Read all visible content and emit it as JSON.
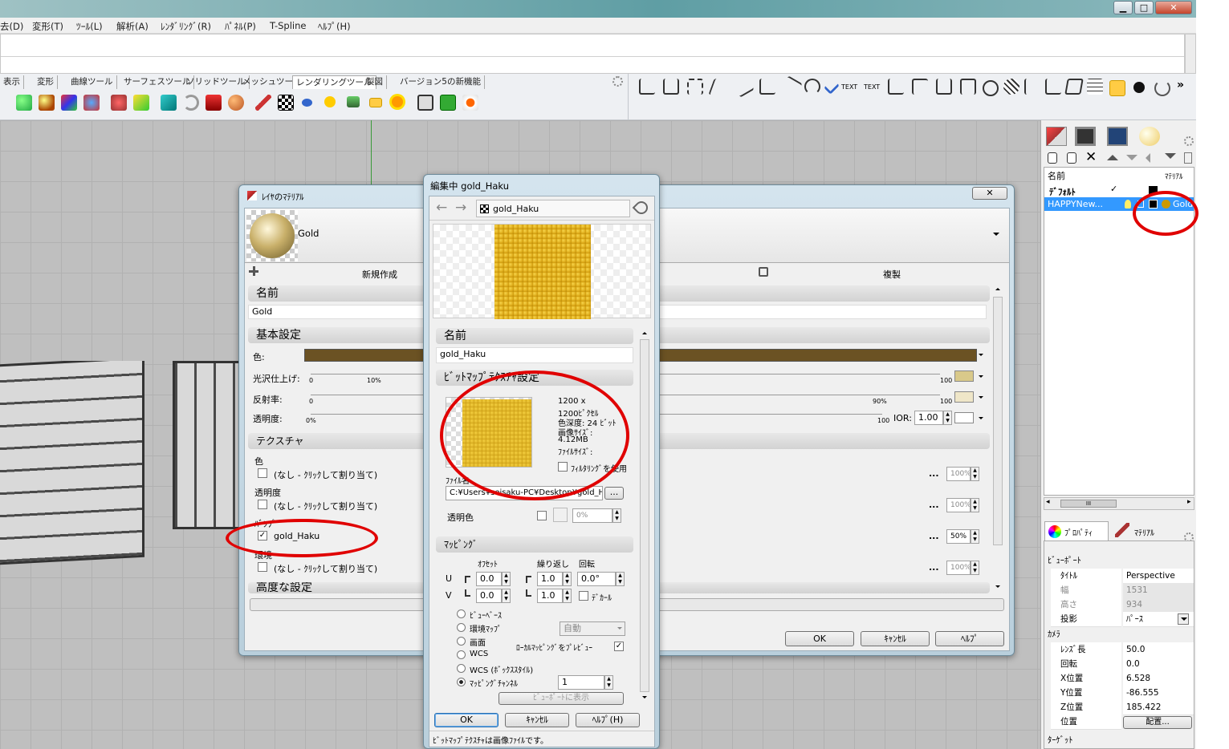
{
  "window": {
    "min": "▁",
    "max": "□",
    "close": "✕"
  },
  "menu": [
    "去(D)",
    "変形(T)",
    "ﾂｰﾙ(L)",
    "解析(A)",
    "ﾚﾝﾀﾞﾘﾝｸﾞ(R)",
    "ﾊﾟﾈﾙ(P)",
    "T-Spline",
    "ﾍﾙﾌﾟ(H)"
  ],
  "toolbar_tabs": [
    "表示",
    "変形",
    "曲線ツール",
    "サーフェスツール",
    "ソリッドツール",
    "メッシュツール",
    "レンダリングツール",
    "製図",
    "バージョン5の新機能"
  ],
  "toolbar_right_text": [
    "TEXT",
    "TEXT",
    "»"
  ],
  "right_panel": {
    "columns": {
      "name": "名前",
      "material": "ﾏﾃﾘｱﾙ"
    },
    "layers": [
      {
        "name": "ﾃﾞﾌｫﾙﾄ",
        "check": "✓",
        "material": ""
      },
      {
        "name": "HAPPYNew...",
        "check": "",
        "material": "Gold"
      }
    ],
    "scroll_label": "III",
    "tabs": {
      "properties": "ﾌﾟﾛﾊﾟﾃｨ",
      "material": "ﾏﾃﾘｱﾙ"
    },
    "viewport_label": "ﾋﾞｭｰﾎﾟｰﾄ",
    "viewport_props": [
      {
        "k": "ﾀｲﾄﾙ",
        "v": "Perspective"
      },
      {
        "k": "幅",
        "v": "1531"
      },
      {
        "k": "高さ",
        "v": "934"
      },
      {
        "k": "投影",
        "v": "ﾊﾟｰｽ"
      }
    ],
    "camera_label": "ｶﾒﾗ",
    "camera_props": [
      {
        "k": "ﾚﾝｽﾞ長",
        "v": "50.0"
      },
      {
        "k": "回転",
        "v": "0.0"
      },
      {
        "k": "X位置",
        "v": "6.528"
      },
      {
        "k": "Y位置",
        "v": "-86.555"
      },
      {
        "k": "Z位置",
        "v": "185.422"
      },
      {
        "k": "位置",
        "v": "配置..."
      }
    ],
    "target_label": "ﾀｰｹﾞｯﾄ"
  },
  "layer_material_dialog": {
    "title": "ﾚｲﾔのﾏﾃﾘｱﾙ",
    "material_name": "Gold",
    "new_label": "新規作成",
    "dup_label": "複製",
    "name_section": "名前",
    "name_value": "Gold",
    "basic_section": "基本設定",
    "color_label": "色:",
    "gloss_label": "光沢仕上げ:",
    "gloss_min": "0",
    "gloss_mark": "10%",
    "gloss_max": "100",
    "refl_label": "反射率:",
    "refl_min": "0",
    "refl_mark": "90%",
    "refl_max": "100",
    "trans_label": "透明度:",
    "trans_min": "0%",
    "trans_max": "100",
    "ior_label": "IOR:",
    "ior_value": "1.00",
    "texture_section": "テクスチャ",
    "tex_color_label": "色",
    "tex_none": "(なし - ｸﾘｯｸして割り当て)",
    "tex_trans_label": "透明度",
    "tex_bump_label": "ﾊﾞﾝﾌﾟ",
    "tex_bump_value": "gold_Haku",
    "tex_env_label": "環境",
    "pct_color": "100%",
    "pct_trans": "100%",
    "pct_bump": "50%",
    "pct_env": "100%",
    "dots": "...",
    "advanced_section": "高度な設定",
    "ok": "OK",
    "cancel": "ｷｬﾝｾﾙ",
    "help": "ﾍﾙﾌﾟ"
  },
  "texture_dialog": {
    "title": "編集中 gold_Haku",
    "breadcrumb": "gold_Haku",
    "name_section": "名前",
    "name_value": "gold_Haku",
    "bitmap_section": "ﾋﾞｯﾄﾏｯﾌﾟﾃｸｽﾁｬ設定",
    "info": [
      "1200 x",
      "1200ﾋﾟｸｾﾙ",
      "色深度: 24 ﾋﾞｯﾄ",
      "画像ｻｲｽﾞ:",
      "4.12MB",
      "ﾌｧｲﾙｻｲｽﾞ:"
    ],
    "filter_label": "ﾌｨﾙﾀﾘﾝｸﾞを使用",
    "file_label": "ﾌｧｲﾙ名",
    "file_value": "C:¥Users¥seisaku-PC¥Desktop¥gold_Haku",
    "browse": "...",
    "trans_color_label": "透明色",
    "trans_pct": "0%",
    "mapping_section": "ﾏｯﾋﾟﾝｸﾞ",
    "offset_label": "ｵﾌｾｯﾄ",
    "repeat_label": "繰り返し",
    "rotation_label": "回転",
    "u_label": "U",
    "v_label": "V",
    "u_offset": "0.0",
    "v_offset": "0.0",
    "u_repeat": "1.0",
    "v_repeat": "1.0",
    "rotation": "0.0°",
    "decal_label": "ﾃﾞｶｰﾙ",
    "modes": [
      "ﾋﾞｭｰﾍﾞｰｽ",
      "環境ﾏｯﾌﾟ",
      "画面",
      "WCS",
      "WCS (ﾎﾞｯｸｽｽﾀｲﾙ)",
      "ﾏｯﾋﾟﾝｸﾞﾁｬﾝﾈﾙ"
    ],
    "auto_value": "自動",
    "preview_label": "ﾛｰｶﾙﾏｯﾋﾟﾝｸﾞをﾌﾟﾚﾋﾞｭｰ",
    "channel_value": "1",
    "show_in_vp": "ﾋﾞｭｰﾎﾟｰﾄに表示",
    "ok": "OK",
    "cancel": "ｷｬﾝｾﾙ",
    "help": "ﾍﾙﾌﾟ(H)",
    "status": "ﾋﾞｯﾄﾏｯﾌﾟﾃｸｽﾁｬは画像ﾌｧｲﾙです。"
  },
  "colors": {
    "material_color": "#6b5223",
    "gloss_swatch": "#d9c98a",
    "refl_swatch": "#efe6c8",
    "gold": "#e0b020",
    "red_annotation": "#e00000"
  }
}
